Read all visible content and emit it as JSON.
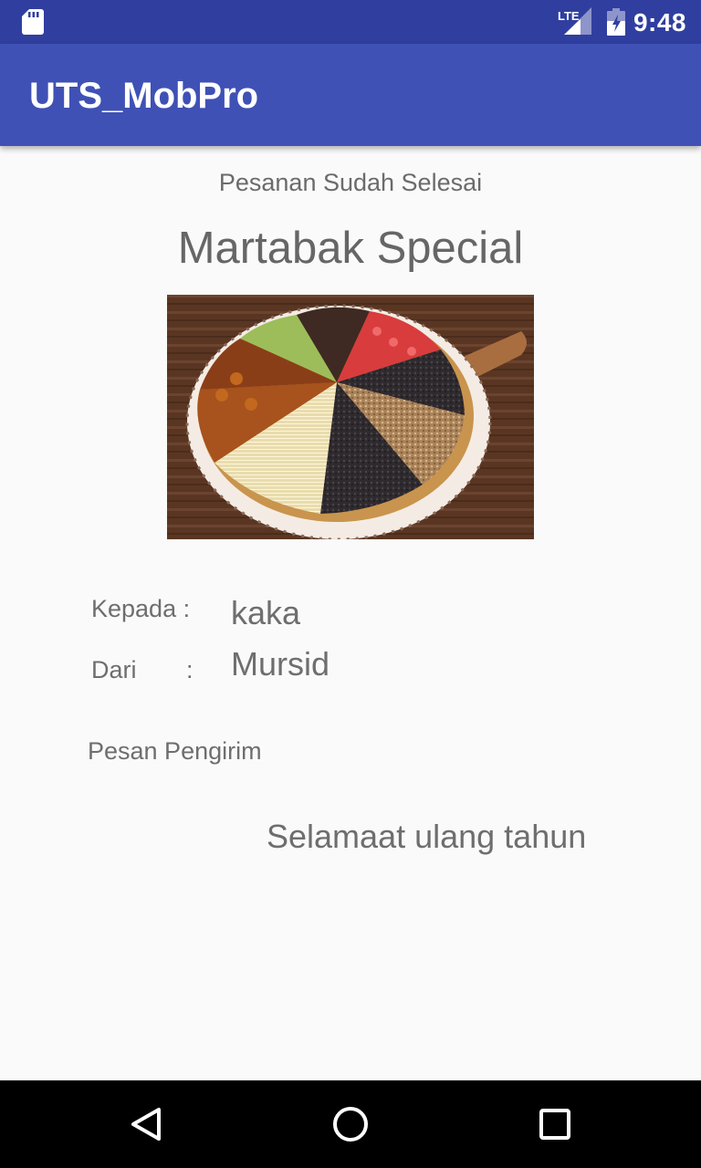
{
  "status_bar": {
    "time": "9:48",
    "network_label": "LTE",
    "icons": [
      "sd-card-icon",
      "lte-signal-icon",
      "battery-icon"
    ]
  },
  "app_bar": {
    "title": "UTS_MobPro"
  },
  "order": {
    "status": "Pesanan Sudah Selesai",
    "product_name": "Martabak Special",
    "image": "martabak-image",
    "to_label": "Kepada :",
    "to_value": "kaka",
    "from_label": "Dari",
    "from_colon": ":",
    "from_value": "Mursid",
    "message_label": "Pesan Pengirim",
    "message_value": "Selamaat ulang tahun"
  },
  "nav_bar": {
    "icons": [
      "back-icon",
      "home-icon",
      "recents-icon"
    ]
  },
  "colors": {
    "status_bar": "#303f9f",
    "app_bar": "#3f51b5",
    "background": "#fafafa",
    "text": "#6e6e6e"
  }
}
